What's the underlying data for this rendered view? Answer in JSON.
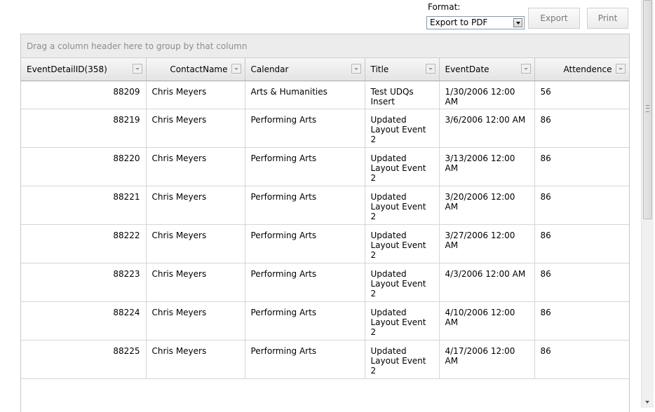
{
  "toolbar": {
    "format_label": "Format:",
    "format_value": "Export to PDF",
    "export_label": "Export",
    "print_label": "Print"
  },
  "grid": {
    "group_panel_text": "Drag a column header here to group by that column",
    "columns": [
      "EventDetailID(358)",
      "ContactName",
      "Calendar",
      "Title",
      "EventDate",
      "Attendence"
    ],
    "rows": [
      {
        "id": "88209",
        "contact": "Chris Meyers",
        "calendar": "Arts & Humanities",
        "title": "Test UDQs Insert",
        "date": "1/30/2006 12:00 AM",
        "attendence": "56"
      },
      {
        "id": "88219",
        "contact": "Chris Meyers",
        "calendar": "Performing Arts",
        "title": "Updated Layout Event 2",
        "date": "3/6/2006 12:00 AM",
        "attendence": "86"
      },
      {
        "id": "88220",
        "contact": "Chris Meyers",
        "calendar": "Performing Arts",
        "title": "Updated Layout Event 2",
        "date": "3/13/2006 12:00 AM",
        "attendence": "86"
      },
      {
        "id": "88221",
        "contact": "Chris Meyers",
        "calendar": "Performing Arts",
        "title": "Updated Layout Event 2",
        "date": "3/20/2006 12:00 AM",
        "attendence": "86"
      },
      {
        "id": "88222",
        "contact": "Chris Meyers",
        "calendar": "Performing Arts",
        "title": "Updated Layout Event 2",
        "date": "3/27/2006 12:00 AM",
        "attendence": "86"
      },
      {
        "id": "88223",
        "contact": "Chris Meyers",
        "calendar": "Performing Arts",
        "title": "Updated Layout Event 2",
        "date": "4/3/2006 12:00 AM",
        "attendence": "86"
      },
      {
        "id": "88224",
        "contact": "Chris Meyers",
        "calendar": "Performing Arts",
        "title": "Updated Layout Event 2",
        "date": "4/10/2006 12:00 AM",
        "attendence": "86"
      },
      {
        "id": "88225",
        "contact": "Chris Meyers",
        "calendar": "Performing Arts",
        "title": "Updated Layout Event 2",
        "date": "4/17/2006 12:00 AM",
        "attendence": "86"
      }
    ]
  }
}
